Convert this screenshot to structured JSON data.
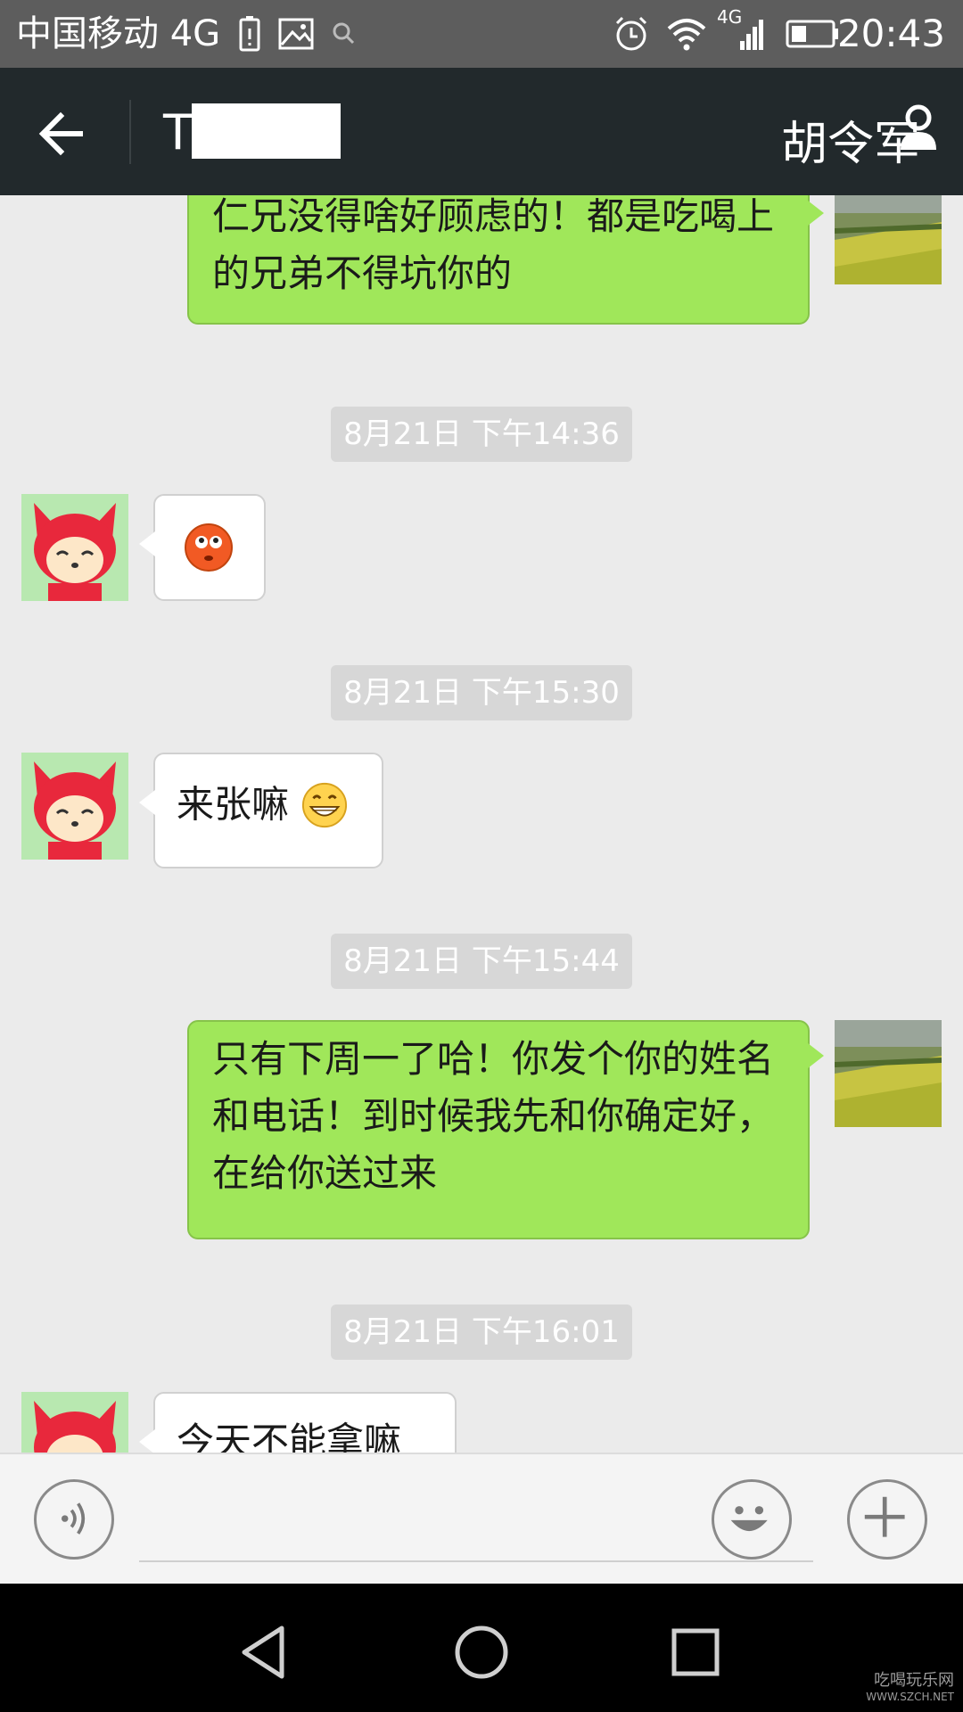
{
  "status_bar": {
    "carrier": "中国移动 4G",
    "time": "20:43",
    "network_label": "4G",
    "icons": [
      "battery-alert-icon",
      "image-icon",
      "search-icon",
      "alarm-icon",
      "wifi-icon",
      "signal-icon",
      "battery-icon"
    ]
  },
  "header": {
    "title": "T",
    "contact_name": "胡令军",
    "back_icon": "arrow-left-icon",
    "contact_icon": "person-icon"
  },
  "messages": [
    {
      "type": "out",
      "text": "仁兄没得啥好顾虑的！都是吃喝上的兄弟不得坑你的"
    },
    {
      "type": "time",
      "text": "8月21日 下午14:36"
    },
    {
      "type": "in",
      "emoji": "blushing-face-emoji"
    },
    {
      "type": "time",
      "text": "8月21日 下午15:30"
    },
    {
      "type": "in",
      "text": "来张嘛",
      "emoji": "grinning-face-emoji"
    },
    {
      "type": "time",
      "text": "8月21日 下午15:44"
    },
    {
      "type": "out",
      "text": "只有下周一了哈！你发个你的姓名和电话！到时候我先和你确定好，在给你送过来"
    },
    {
      "type": "time",
      "text": "8月21日 下午16:01"
    },
    {
      "type": "in",
      "text": "今天不能拿嘛"
    }
  ],
  "input_bar": {
    "voice_icon": "voice-icon",
    "emoji_icon": "smiley-icon",
    "more_icon": "plus-icon",
    "value": ""
  },
  "nav_bar": {
    "icons": [
      "back-triangle-icon",
      "home-circle-icon",
      "recents-square-icon"
    ]
  },
  "watermark": {
    "text": "吃喝玩乐网",
    "url": "WWW.SZCH.NET"
  },
  "colors": {
    "status_bar": "#5d5d5d",
    "header": "#22292c",
    "chat_background": "#ebebeb",
    "outgoing_bubble": "#a0e75a",
    "incoming_bubble": "#ffffff",
    "timestamp_bg": "#d7d7d7"
  }
}
